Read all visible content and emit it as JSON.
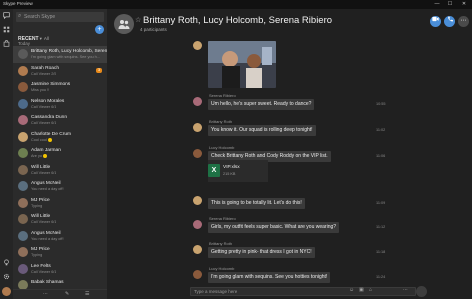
{
  "window": {
    "title": "Skype Preview",
    "minimize": "—",
    "maximize": "☐",
    "close": "✕"
  },
  "rail": {
    "chats_icon": "chat-icon",
    "contacts_icon": "contacts-icon",
    "shop_icon": "bag-icon",
    "bottom_icons": [
      "lightbulb-icon",
      "gear-icon",
      "user-avatar"
    ]
  },
  "sidebar": {
    "search_placeholder": "Search Skype",
    "recent_label": "RECENT",
    "recent_chevron": "▾",
    "recent_count": "All",
    "add_button": "+",
    "today_label": "Today",
    "contacts": [
      {
        "name": "Brittany Roth, Lucy Holcomb, Serena...",
        "status": "I'm going glam with sequins. See you h...",
        "active": true,
        "avatar_color": "#5a5a5a"
      },
      {
        "name": "Sarah Roach",
        "status": "Call Viewer 2/5",
        "badge": "3",
        "avatar_color": "#b07b4f"
      },
      {
        "name": "Jasmine Simmons",
        "status": "Miss you !!",
        "avatar_color": "#8a5a3c"
      },
      {
        "name": "Nelson Morales",
        "status": "Call Viewer 6/1",
        "avatar_color": "#4d6a8a"
      },
      {
        "name": "Cassandra Dunn",
        "status": "Call Viewer 6/1",
        "avatar_color": "#a86a78"
      },
      {
        "name": "Charlotte De Crum",
        "status": "Cool cool",
        "emoji": true,
        "avatar_color": "#c9a36f"
      },
      {
        "name": "Adam Jarman",
        "status": "Are yo",
        "emoji": true,
        "avatar_color": "#6d7f50"
      },
      {
        "name": "Will Little",
        "status": "Call Viewer 6/1",
        "avatar_color": "#7a6550"
      },
      {
        "name": "Angus McNeil",
        "status": "You need a day off!",
        "avatar_color": "#5a6e7e"
      },
      {
        "name": "MJ Price",
        "status": "Typing",
        "avatar_color": "#8f6f5a"
      },
      {
        "name": "Will Little",
        "status": "Call Viewer 6/1",
        "avatar_color": "#7a6550"
      },
      {
        "name": "Angus McNeil",
        "status": "You need a day off!",
        "avatar_color": "#5a6e7e"
      },
      {
        "name": "MJ Price",
        "status": "Typing",
        "avatar_color": "#8f6f5a"
      },
      {
        "name": "Lee Felts",
        "status": "Call Viewer 6/1",
        "avatar_color": "#6a5a7a"
      },
      {
        "name": "Babak Shamas",
        "status": "",
        "avatar_color": "#7a7a5a"
      }
    ],
    "footer": [
      "⋯",
      "✎",
      "☰"
    ]
  },
  "chat": {
    "title": "Brittany Roth, Lucy Holcomb, Serena Ribiero",
    "star": "☆",
    "participants": "4 participants",
    "video_call_icon": "video-icon",
    "call_icon": "phone-icon",
    "add_icon": "add-people-icon",
    "messages": [
      {
        "kind": "photo",
        "time": "",
        "avatar_color": "#c9a36f"
      },
      {
        "kind": "text",
        "sender": "Serena Ribiero",
        "text": "Um hello, he's super sweet. Ready to dance?",
        "time": "10:55",
        "avatar_color": "#a86a78"
      },
      {
        "kind": "text",
        "sender": "Brittany Roth",
        "text": "You know it. Our squad is rolling deep tonight!",
        "time": "11:02",
        "avatar_color": "#c9a36f"
      },
      {
        "kind": "text",
        "sender": "Lucy Holcomb",
        "text": "Check Brittany Roth and Cody Roddy on the VIP list.",
        "time": "11:06",
        "avatar_color": "#8a5a3c"
      },
      {
        "kind": "file",
        "filename": "VIP.xlsx",
        "filesize": "215 KB",
        "time": "",
        "avatar_color": "#8a5a3c"
      },
      {
        "kind": "text",
        "sender": "",
        "text": "This is going to be totally lit. Let's do this!",
        "time": "11:09",
        "avatar_color": "#c9a36f"
      },
      {
        "kind": "text",
        "sender": "Serena Ribiero",
        "text": "Girls, my outfit feels super basic. What are you wearing?",
        "time": "11:12",
        "avatar_color": "#a86a78"
      },
      {
        "kind": "text",
        "sender": "Brittany Roth",
        "text": "Getting pretty in pink- that dress I got in NYC!",
        "time": "11:18",
        "avatar_color": "#c9a36f"
      },
      {
        "kind": "text",
        "sender": "Lucy Holcomb",
        "text": "I'm going glam with sequins. See you hotties tonight!",
        "time": "11:24",
        "avatar_color": "#8a5a3c"
      }
    ],
    "composer": {
      "placeholder": "Type a message here",
      "emoji_icon": "☺",
      "image_icon": "▣",
      "attach_icon": "⌂",
      "more_icon": "⋯"
    }
  },
  "colors": {
    "accent": "#4a8ed8",
    "badge": "#e88a1a",
    "excel": "#1e7145"
  }
}
